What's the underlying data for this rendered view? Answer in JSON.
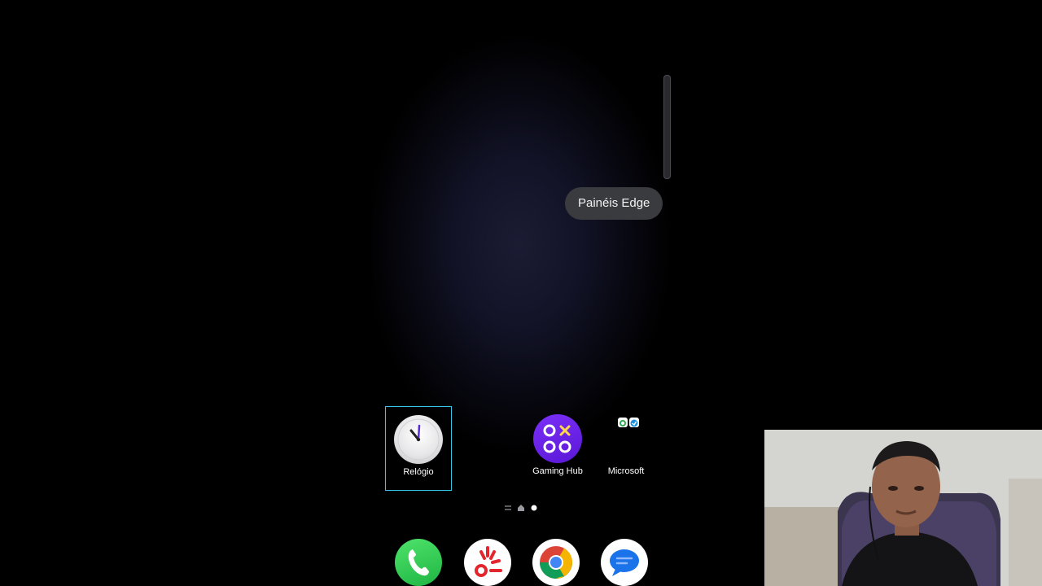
{
  "edge_panel": {
    "tooltip": "Painéis Edge"
  },
  "home_apps": [
    {
      "label": "Relógio",
      "icon": "clock-icon",
      "selected": true
    },
    {
      "label": "Gaming Hub",
      "icon": "gaming-hub-icon",
      "selected": false
    },
    {
      "label": "Microsoft",
      "icon": "folder-icon",
      "selected": false
    }
  ],
  "page_indicator": {
    "pages": [
      "menu",
      "home",
      "page-1"
    ],
    "current": 2
  },
  "dock": [
    {
      "icon": "phone-icon"
    },
    {
      "icon": "app-icon"
    },
    {
      "icon": "chrome-icon"
    },
    {
      "icon": "messages-icon"
    }
  ],
  "colors": {
    "selection_outline": "#35c6e8",
    "tooltip_bg": "#3a3b3f",
    "gaming_hub": "#6a22e8",
    "phone_green": "#2fcf52"
  }
}
